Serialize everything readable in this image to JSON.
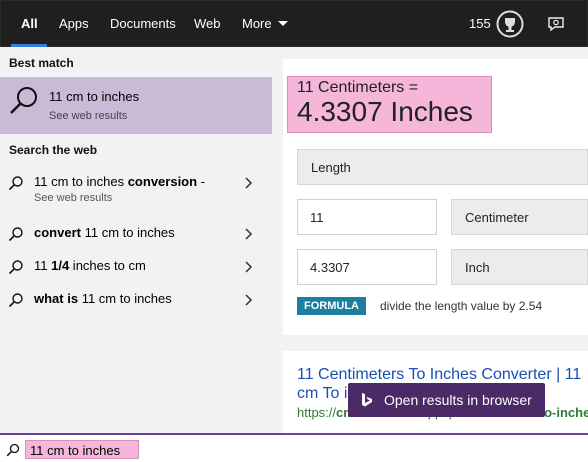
{
  "tabs": [
    {
      "label": "All"
    },
    {
      "label": "Apps"
    },
    {
      "label": "Documents"
    },
    {
      "label": "Web"
    },
    {
      "label": "More"
    }
  ],
  "header": {
    "points": "155"
  },
  "left": {
    "best_match_heading": "Best match",
    "best_match": {
      "title": "11 cm to inches",
      "subtitle": "See web results"
    },
    "search_web_heading": "Search the web",
    "suggestions": [
      {
        "plain": "11 cm to inches ",
        "bold": "conversion",
        "after": " -",
        "sub": "See web results"
      },
      {
        "bold": "convert",
        "plain": " 11 cm to inches"
      },
      {
        "plain": "11 ",
        "bold": "1/4",
        "after": " inches to cm"
      },
      {
        "bold": "what is",
        "plain": " 11 cm to inches"
      }
    ]
  },
  "converter": {
    "line1": "11 Centimeters =",
    "line2": "4.3307 Inches",
    "measure": "Length",
    "from_value": "11",
    "from_unit": "Centimeter",
    "to_value": "4.3307",
    "to_unit": "Inch",
    "formula_badge": "FORMULA",
    "formula_text": "divide the length value by 2.54"
  },
  "web_result": {
    "title_line1": "11 Centimeters To Inches Converter | 11",
    "title_line2": "cm To i",
    "url_prefix": "https://",
    "url_bold_a": "cm-to-inches",
    "url_mid": ".appspot.com/",
    "url_bold_b": "11-cm-to-inche"
  },
  "open_button": {
    "label": "Open results in browser"
  },
  "search": {
    "query": "11 cm to inches"
  },
  "colors": {
    "accent": "#2f7ed8",
    "selection": "#cbbad6",
    "highlight": "#f5b6d9",
    "bing_purple": "#4a2a67",
    "formula": "#1c7fa0"
  }
}
